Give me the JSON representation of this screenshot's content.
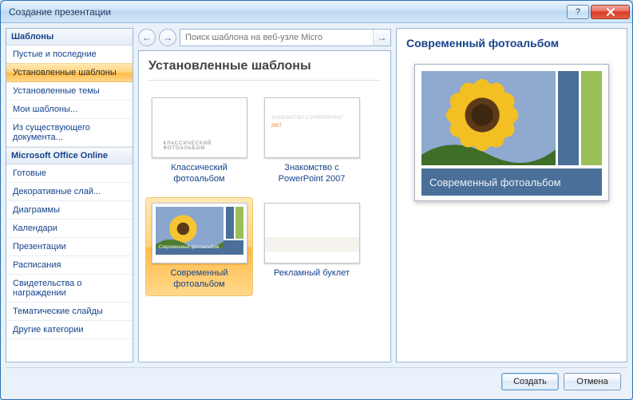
{
  "window": {
    "title": "Создание презентации"
  },
  "sidebar": {
    "sections": [
      {
        "header": "Шаблоны",
        "items": [
          {
            "label": "Пустые и последние"
          },
          {
            "label": "Установленные шаблоны",
            "selected": true
          },
          {
            "label": "Установленные темы"
          },
          {
            "label": "Мои шаблоны..."
          },
          {
            "label": "Из существующего документа..."
          }
        ]
      },
      {
        "header": "Microsoft Office Online",
        "items": [
          {
            "label": "Готовые"
          },
          {
            "label": "Декоративные слай..."
          },
          {
            "label": "Диаграммы"
          },
          {
            "label": "Календари"
          },
          {
            "label": "Презентации"
          },
          {
            "label": "Расписания"
          },
          {
            "label": "Свидетельства о награждении"
          },
          {
            "label": "Тематические слайды"
          },
          {
            "label": "Другие категории"
          }
        ]
      }
    ]
  },
  "search": {
    "placeholder": "Поиск шаблона на веб-узле Micro"
  },
  "gallery": {
    "title": "Установленные шаблоны",
    "items": [
      {
        "label": "Классический фотоальбом",
        "thumb": "dark1",
        "thumb_text": "КЛАССИЧЕСКИЙ ФОТОАЛЬБОМ"
      },
      {
        "label": "Знакомство с PowerPoint 2007",
        "thumb": "dark2",
        "thumb_t1": "ЗНАКОМСТВО С POWERPOINT",
        "thumb_t2": "2007"
      },
      {
        "label": "Современный фотоальбом",
        "thumb": "modern",
        "thumb_caption": "Современный фотоальбом",
        "selected": true
      },
      {
        "label": "Рекламный буклет",
        "thumb": "ad"
      }
    ]
  },
  "preview": {
    "title": "Современный фотоальбом",
    "caption": "Современный фотоальбом"
  },
  "buttons": {
    "create": "Создать",
    "cancel": "Отмена"
  }
}
